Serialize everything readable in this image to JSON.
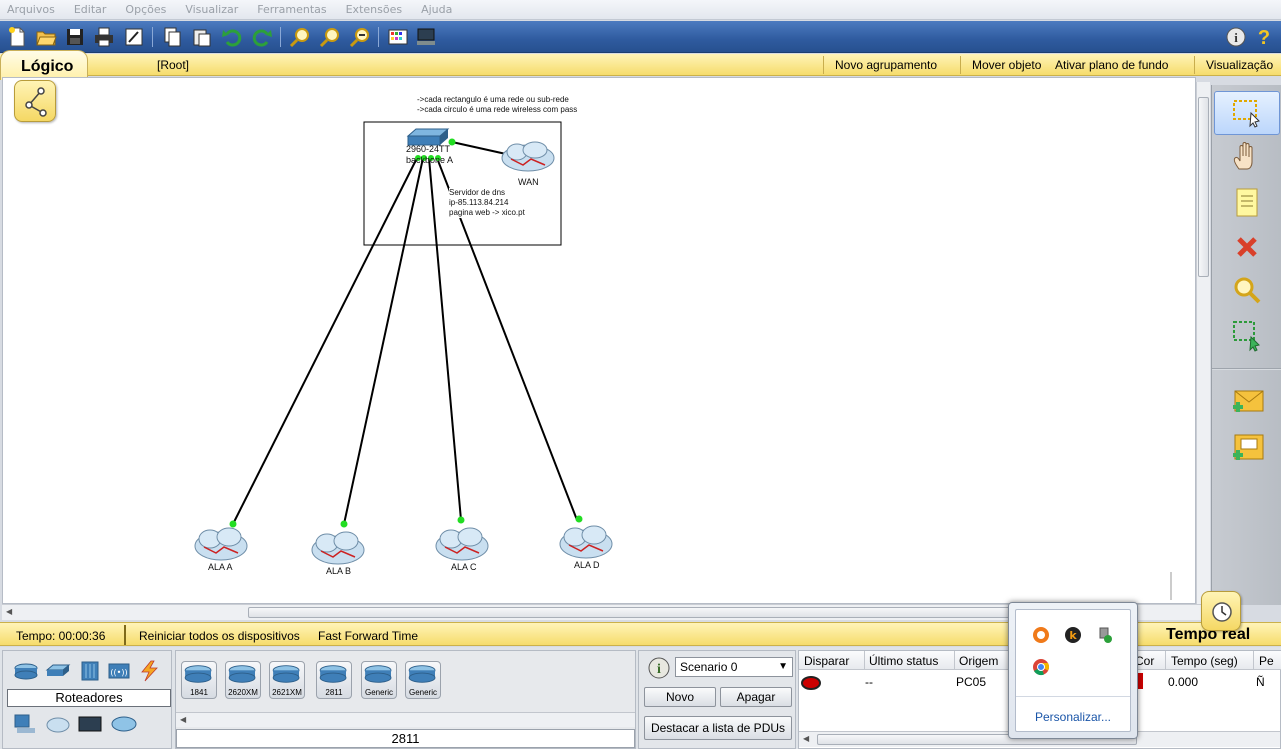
{
  "menu": [
    "Arquivos",
    "Editar",
    "Opções",
    "Visualizar",
    "Ferramentas",
    "Extensões",
    "Ajuda"
  ],
  "logical_bar": {
    "tab_label": "Lógico",
    "root_label": "[Root]",
    "new_cluster": "Novo agrupamento",
    "move_object": "Mover objeto",
    "set_background": "Ativar plano de fundo",
    "viewport": "Visualização"
  },
  "canvas": {
    "note_line1": "->cada rectangulo é uma rede ou sub-rede",
    "note_line2": "->cada circulo é uma rede wireless com pass",
    "switch_label_line1": "2960-24TT",
    "switch_label_line2": "backbone A",
    "wan_label": "WAN",
    "server_note_line1": "Servidor de dns",
    "server_note_line2": "ip-85.113.84.214",
    "server_note_line3": "pagina web -> xico.pt",
    "cloud_a": "ALA  A",
    "cloud_b": "ALA B",
    "cloud_c": "ALA C",
    "cloud_d": "ALA D"
  },
  "timebar": {
    "time": "Tempo: 00:00:36",
    "power_cycle": "Reiniciar todos os dispositivos",
    "fast_forward": "Fast Forward Time",
    "realtime_tab": "Tempo real"
  },
  "device_panel": {
    "category_label": "Roteadores",
    "models": [
      "1841",
      "2620XM",
      "2621XM",
      "2811",
      "Generic",
      "Generic"
    ],
    "selected_model": "2811"
  },
  "scenario": {
    "selected": "Scenario 0",
    "new_button": "Novo",
    "delete_button": "Apagar",
    "toggle_pdu_list": "Destacar a lista de PDUs"
  },
  "pdu_table": {
    "headers": [
      "Disparar",
      "Último status",
      "Origem",
      "Cor",
      "Tempo (seg)",
      "Pe"
    ],
    "row": {
      "status": "--",
      "source": "PC05",
      "time": "0.000",
      "periodic": "Ñ"
    }
  },
  "tray": {
    "customize_link": "Personalizar..."
  },
  "colors": {
    "toolbar_blue": "#2f5b9f",
    "yellow_bar": "#f6dc6c",
    "link_green": "#22dd22",
    "pdu_red": "#cc0000"
  }
}
